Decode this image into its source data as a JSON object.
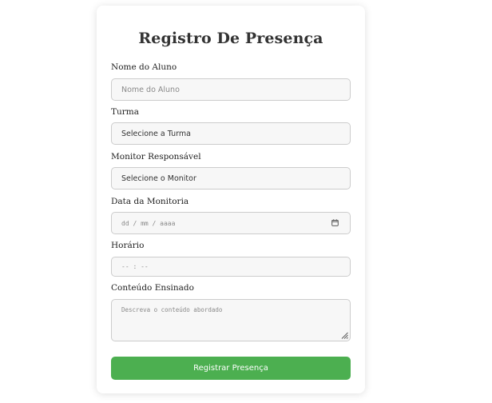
{
  "form": {
    "title": "Registro De Presença",
    "fields": {
      "nome": {
        "label": "Nome do Aluno",
        "placeholder": "Nome do Aluno",
        "value": ""
      },
      "turma": {
        "label": "Turma",
        "value": "Selecione a Turma"
      },
      "monitor": {
        "label": "Monitor Responsável",
        "value": "Selecione o Monitor"
      },
      "data": {
        "label": "Data da Monitoria",
        "placeholder": "dd / mm / aaaa",
        "icon": "calendar-icon"
      },
      "horario": {
        "label": "Horário",
        "placeholder": "-- : --"
      },
      "conteudo": {
        "label": "Conteúdo Ensinado",
        "placeholder": "Descreva o conteúdo abordado",
        "icon": "resize-handle-icon"
      }
    },
    "submit_label": "Registrar Presença"
  },
  "colors": {
    "accent": "#4caf50",
    "input_bg": "#f7f7f7",
    "input_border": "#cccccc",
    "title": "#333333"
  }
}
